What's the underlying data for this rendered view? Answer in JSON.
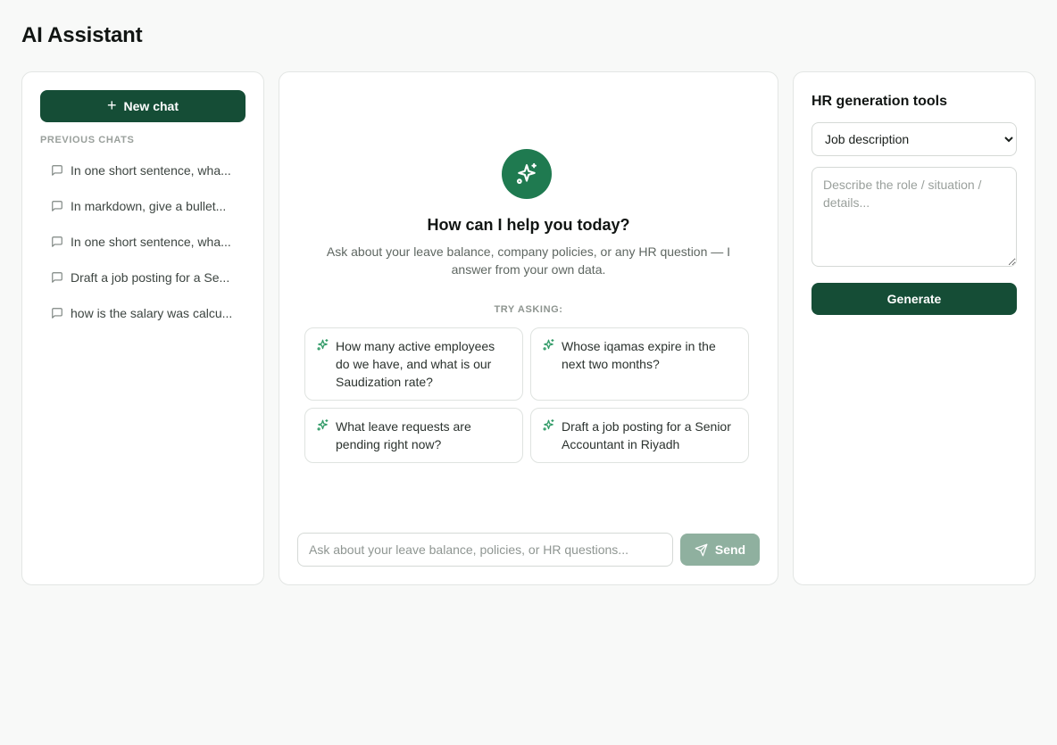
{
  "page": {
    "title": "AI Assistant"
  },
  "sidebar": {
    "new_chat_label": "New chat",
    "section_label": "PREVIOUS CHATS",
    "chats": [
      {
        "label": "In one short sentence, wha..."
      },
      {
        "label": "In markdown, give a bullet..."
      },
      {
        "label": "In one short sentence, wha..."
      },
      {
        "label": "Draft a job posting for a Se..."
      },
      {
        "label": "how is the salary was calcu..."
      }
    ]
  },
  "chat": {
    "welcome_title": "How can I help you today?",
    "welcome_subtitle": "Ask about your leave balance, company policies, or any HR question — I answer from your own data.",
    "try_label": "TRY ASKING:",
    "suggestions": [
      {
        "text": "How many active employees do we have, and what is our Saudization rate?"
      },
      {
        "text": "Whose iqamas expire in the next two months?"
      },
      {
        "text": "What leave requests are pending right now?"
      },
      {
        "text": "Draft a job posting for a Senior Accountant in Riyadh"
      }
    ],
    "input_value": "",
    "input_placeholder": "Ask about your leave balance, policies, or HR questions...",
    "send_label": "Send"
  },
  "tools": {
    "title": "HR generation tools",
    "selected_option": "Job description",
    "textarea_value": "",
    "textarea_placeholder": "Describe the role / situation / details...",
    "generate_label": "Generate"
  },
  "colors": {
    "primary": "#154d36",
    "accent": "#1f7a50",
    "send_disabled": "#8fb09f",
    "background": "#f8f9f8"
  },
  "icons": {
    "new_chat": "plus-icon",
    "chat_item": "message-square-icon",
    "hero": "sparkles-icon",
    "suggestion": "sparkles-icon",
    "send": "send-icon"
  }
}
